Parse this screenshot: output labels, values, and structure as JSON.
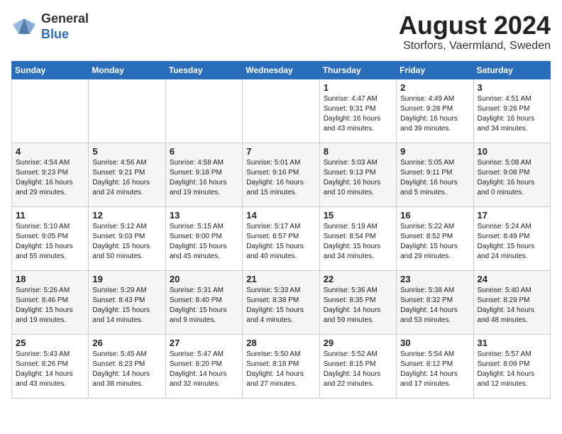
{
  "logo": {
    "general": "General",
    "blue": "Blue"
  },
  "title": "August 2024",
  "subtitle": "Storfors, Vaermland, Sweden",
  "days_header": [
    "Sunday",
    "Monday",
    "Tuesday",
    "Wednesday",
    "Thursday",
    "Friday",
    "Saturday"
  ],
  "weeks": [
    [
      {
        "num": "",
        "info": ""
      },
      {
        "num": "",
        "info": ""
      },
      {
        "num": "",
        "info": ""
      },
      {
        "num": "",
        "info": ""
      },
      {
        "num": "1",
        "info": "Sunrise: 4:47 AM\nSunset: 9:31 PM\nDaylight: 16 hours\nand 43 minutes."
      },
      {
        "num": "2",
        "info": "Sunrise: 4:49 AM\nSunset: 9:28 PM\nDaylight: 16 hours\nand 39 minutes."
      },
      {
        "num": "3",
        "info": "Sunrise: 4:51 AM\nSunset: 9:26 PM\nDaylight: 16 hours\nand 34 minutes."
      }
    ],
    [
      {
        "num": "4",
        "info": "Sunrise: 4:54 AM\nSunset: 9:23 PM\nDaylight: 16 hours\nand 29 minutes."
      },
      {
        "num": "5",
        "info": "Sunrise: 4:56 AM\nSunset: 9:21 PM\nDaylight: 16 hours\nand 24 minutes."
      },
      {
        "num": "6",
        "info": "Sunrise: 4:58 AM\nSunset: 9:18 PM\nDaylight: 16 hours\nand 19 minutes."
      },
      {
        "num": "7",
        "info": "Sunrise: 5:01 AM\nSunset: 9:16 PM\nDaylight: 16 hours\nand 15 minutes."
      },
      {
        "num": "8",
        "info": "Sunrise: 5:03 AM\nSunset: 9:13 PM\nDaylight: 16 hours\nand 10 minutes."
      },
      {
        "num": "9",
        "info": "Sunrise: 5:05 AM\nSunset: 9:11 PM\nDaylight: 16 hours\nand 5 minutes."
      },
      {
        "num": "10",
        "info": "Sunrise: 5:08 AM\nSunset: 9:08 PM\nDaylight: 16 hours\nand 0 minutes."
      }
    ],
    [
      {
        "num": "11",
        "info": "Sunrise: 5:10 AM\nSunset: 9:05 PM\nDaylight: 15 hours\nand 55 minutes."
      },
      {
        "num": "12",
        "info": "Sunrise: 5:12 AM\nSunset: 9:03 PM\nDaylight: 15 hours\nand 50 minutes."
      },
      {
        "num": "13",
        "info": "Sunrise: 5:15 AM\nSunset: 9:00 PM\nDaylight: 15 hours\nand 45 minutes."
      },
      {
        "num": "14",
        "info": "Sunrise: 5:17 AM\nSunset: 8:57 PM\nDaylight: 15 hours\nand 40 minutes."
      },
      {
        "num": "15",
        "info": "Sunrise: 5:19 AM\nSunset: 8:54 PM\nDaylight: 15 hours\nand 34 minutes."
      },
      {
        "num": "16",
        "info": "Sunrise: 5:22 AM\nSunset: 8:52 PM\nDaylight: 15 hours\nand 29 minutes."
      },
      {
        "num": "17",
        "info": "Sunrise: 5:24 AM\nSunset: 8:49 PM\nDaylight: 15 hours\nand 24 minutes."
      }
    ],
    [
      {
        "num": "18",
        "info": "Sunrise: 5:26 AM\nSunset: 8:46 PM\nDaylight: 15 hours\nand 19 minutes."
      },
      {
        "num": "19",
        "info": "Sunrise: 5:29 AM\nSunset: 8:43 PM\nDaylight: 15 hours\nand 14 minutes."
      },
      {
        "num": "20",
        "info": "Sunrise: 5:31 AM\nSunset: 8:40 PM\nDaylight: 15 hours\nand 9 minutes."
      },
      {
        "num": "21",
        "info": "Sunrise: 5:33 AM\nSunset: 8:38 PM\nDaylight: 15 hours\nand 4 minutes."
      },
      {
        "num": "22",
        "info": "Sunrise: 5:36 AM\nSunset: 8:35 PM\nDaylight: 14 hours\nand 59 minutes."
      },
      {
        "num": "23",
        "info": "Sunrise: 5:38 AM\nSunset: 8:32 PM\nDaylight: 14 hours\nand 53 minutes."
      },
      {
        "num": "24",
        "info": "Sunrise: 5:40 AM\nSunset: 8:29 PM\nDaylight: 14 hours\nand 48 minutes."
      }
    ],
    [
      {
        "num": "25",
        "info": "Sunrise: 5:43 AM\nSunset: 8:26 PM\nDaylight: 14 hours\nand 43 minutes."
      },
      {
        "num": "26",
        "info": "Sunrise: 5:45 AM\nSunset: 8:23 PM\nDaylight: 14 hours\nand 38 minutes."
      },
      {
        "num": "27",
        "info": "Sunrise: 5:47 AM\nSunset: 8:20 PM\nDaylight: 14 hours\nand 32 minutes."
      },
      {
        "num": "28",
        "info": "Sunrise: 5:50 AM\nSunset: 8:18 PM\nDaylight: 14 hours\nand 27 minutes."
      },
      {
        "num": "29",
        "info": "Sunrise: 5:52 AM\nSunset: 8:15 PM\nDaylight: 14 hours\nand 22 minutes."
      },
      {
        "num": "30",
        "info": "Sunrise: 5:54 AM\nSunset: 8:12 PM\nDaylight: 14 hours\nand 17 minutes."
      },
      {
        "num": "31",
        "info": "Sunrise: 5:57 AM\nSunset: 8:09 PM\nDaylight: 14 hours\nand 12 minutes."
      }
    ]
  ]
}
